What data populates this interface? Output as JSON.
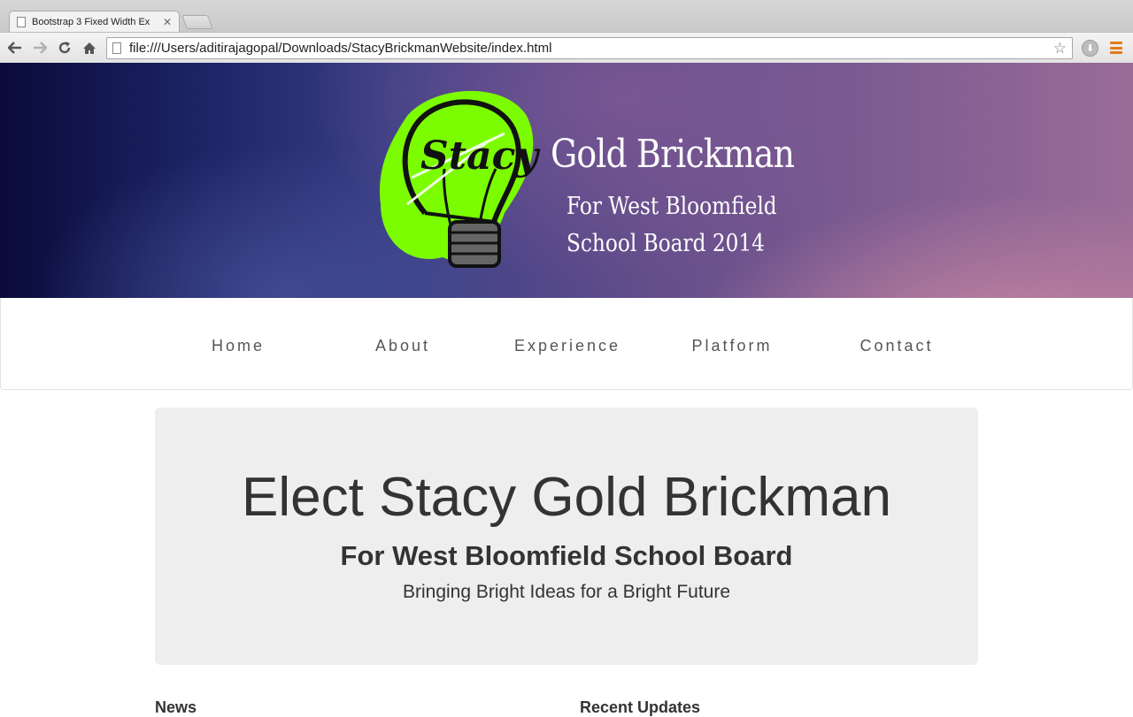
{
  "browser": {
    "tab_title": "Bootstrap 3 Fixed Width Ex",
    "url": "file:///Users/aditirajagopal/Downloads/StacyBrickmanWebsite/index.html"
  },
  "header": {
    "logo_text": "Stacy",
    "brand_name": "Gold Brickman",
    "brand_line1": "For West Bloomfield",
    "brand_line2": "School Board 2014"
  },
  "nav": {
    "items": [
      {
        "label": "Home"
      },
      {
        "label": "About"
      },
      {
        "label": "Experience"
      },
      {
        "label": "Platform"
      },
      {
        "label": "Contact"
      }
    ]
  },
  "jumbotron": {
    "title": "Elect Stacy Gold Brickman",
    "subtitle": "For West Bloomfield School Board",
    "tagline": "Bringing Bright Ideas for a Bright Future"
  },
  "sections": {
    "news": "News",
    "recent_updates": "Recent Updates"
  },
  "colors": {
    "logo_green": "#7cfc00",
    "menu_orange": "#e07b1a",
    "jumbotron_bg": "#eeeeee"
  }
}
